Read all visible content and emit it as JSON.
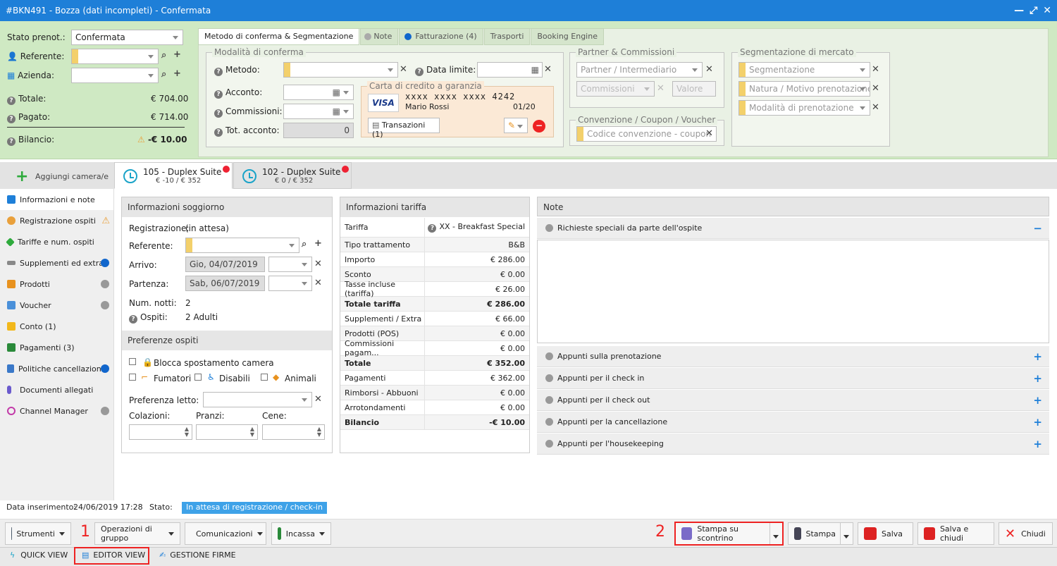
{
  "window": {
    "title": "#BKN491 - Bozza (dati incompleti) - Confermata",
    "min": "—",
    "max": "⤢",
    "close": "✕"
  },
  "header": {
    "stato_label": "Stato prenot.:",
    "stato_value": "Confermata",
    "referente_label": "Referente:",
    "azienda_label": "Azienda:",
    "totale_label": "Totale:",
    "totale_value": "€ 704.00",
    "pagato_label": "Pagato:",
    "pagato_value": "€ 714.00",
    "bilancio_label": "Bilancio:",
    "bilancio_value": "-€ 10.00"
  },
  "tabs": [
    "Metodo di conferma & Segmentazione",
    "Note",
    "Fatturazione (4)",
    "Trasporti",
    "Booking Engine"
  ],
  "conferma": {
    "legend": "Modalità di conferma",
    "metodo": "Metodo:",
    "data_limite": "Data limite:",
    "acconto": "Acconto:",
    "commissioni": "Commissioni:",
    "tot_acconto": "Tot. acconto:",
    "tot_acconto_value": "0",
    "carta_legend": "Carta di credito a garanzia",
    "card_brand": "VISA",
    "card_number": "xxxx xxxx xxxx 4242",
    "card_holder": "Mario Rossi",
    "card_exp": "01/20",
    "transazioni": "Transazioni (1)"
  },
  "partner": {
    "legend": "Partner & Commissioni",
    "partner_ph": "Partner / Intermediario",
    "commissioni_ph": "Commissioni",
    "valore_ph": "Valore"
  },
  "convenzione": {
    "legend": "Convenzione / Coupon / Voucher",
    "codice_ph": "Codice convenzione - coupon"
  },
  "segmentazione": {
    "legend": "Segmentazione di mercato",
    "seg_ph": "Segmentazione",
    "natura_ph": "Natura / Motivo prenotazione",
    "modalita_ph": "Modalità di prenotazione"
  },
  "rooms": {
    "add": "Aggiungi camera/e",
    "tabs": [
      {
        "name": "105 - Duplex Suite",
        "sub": "€ -10 / € 352"
      },
      {
        "name": "102 - Duplex Suite",
        "sub": "€ 0 / € 352"
      }
    ]
  },
  "sidebar": [
    {
      "label": "Informazioni e note",
      "color": "#1e7fd8",
      "dot": ""
    },
    {
      "label": "Registrazione ospiti",
      "color": "#e9a03b",
      "dot": "warn"
    },
    {
      "label": "Tariffe e num. ospiti",
      "color": "#2eaa3c",
      "dot": ""
    },
    {
      "label": "Supplementi ed extra",
      "color": "#888",
      "dot": "#1166cc"
    },
    {
      "label": "Prodotti",
      "color": "#e8921f",
      "dot": "#999"
    },
    {
      "label": "Voucher",
      "color": "#4a90d9",
      "dot": "#999"
    },
    {
      "label": "Conto (1)",
      "color": "#f2b81b",
      "dot": ""
    },
    {
      "label": "Pagamenti (3)",
      "color": "#2a8a3a",
      "dot": ""
    },
    {
      "label": "Politiche cancellazione",
      "color": "#3a78c8",
      "dot": "#1166cc"
    },
    {
      "label": "Documenti allegati",
      "color": "#6a5acd",
      "dot": ""
    },
    {
      "label": "Channel Manager",
      "color": "#c23aa8",
      "dot": "#999"
    }
  ],
  "soggiorno": {
    "title": "Informazioni soggiorno",
    "registrazione_label": "Registrazione:",
    "registrazione_value": "(in attesa)",
    "referente": "Referente:",
    "arrivo": "Arrivo:",
    "arrivo_value": "Gio, 04/07/2019",
    "partenza": "Partenza:",
    "partenza_value": "Sab, 06/07/2019",
    "notti": "Num. notti:",
    "notti_value": "2",
    "ospiti": "Ospiti:",
    "ospiti_value": "2 Adulti"
  },
  "preferenze": {
    "title": "Preferenze ospiti",
    "blocca": "Blocca spostamento camera",
    "fumatori": "Fumatori",
    "disabili": "Disabili",
    "animali": "Animali",
    "letto": "Preferenza letto:",
    "colazioni": "Colazioni:",
    "pranzi": "Pranzi:",
    "cene": "Cene:"
  },
  "tariffa": {
    "title": "Informazioni tariffa",
    "rows": [
      {
        "k": "Tariffa",
        "v": "XX - Breakfast Special",
        "b": false
      },
      {
        "k": "Tipo trattamento",
        "v": "B&B",
        "b": false
      },
      {
        "k": "Importo",
        "v": "€ 286.00",
        "b": false
      },
      {
        "k": "Sconto",
        "v": "€ 0.00",
        "b": false
      },
      {
        "k": "Tasse incluse (tariffa)",
        "v": "€ 26.00",
        "b": false
      },
      {
        "k": "Totale tariffa",
        "v": "€ 286.00",
        "b": true
      },
      {
        "k": "Supplementi / Extra",
        "v": "€ 66.00",
        "b": false
      },
      {
        "k": "Prodotti (POS)",
        "v": "€ 0.00",
        "b": false
      },
      {
        "k": "Commissioni pagam...",
        "v": "€ 0.00",
        "b": false
      },
      {
        "k": "Totale",
        "v": "€ 352.00",
        "b": true
      },
      {
        "k": "Pagamenti",
        "v": "€ 362.00",
        "b": false
      },
      {
        "k": "Rimborsi - Abbuoni",
        "v": "€ 0.00",
        "b": false
      },
      {
        "k": "Arrotondamenti",
        "v": "€ 0.00",
        "b": false
      },
      {
        "k": "Bilancio",
        "v": "-€ 10.00",
        "b": true
      }
    ]
  },
  "note": {
    "title": "Note",
    "richieste": "Richieste speciali da parte dell'ospite",
    "collapse": "−",
    "items": [
      "Appunti sulla prenotazione",
      "Appunti per il check in",
      "Appunti per il check out",
      "Appunti per la cancellazione",
      "Appunti per l'housekeeping"
    ],
    "expand": "+"
  },
  "info": {
    "data_label": "Data inserimento:",
    "data_value": "24/06/2019 17:28",
    "stato_label": "Stato:",
    "stato_value": "In attesa di registrazione / check-in"
  },
  "footer": {
    "strumenti": "Strumenti",
    "operazioni": "Operazioni di gruppo",
    "comunicazioni": "Comunicazioni",
    "incassa": "Incassa",
    "stampa_scontrino": "Stampa su scontrino",
    "stampa": "Stampa",
    "salva": "Salva",
    "salva_chiudi": "Salva e chiudi",
    "chiudi": "Chiudi",
    "mark1": "1",
    "mark2": "2"
  },
  "bottombar": {
    "quick": "QUICK VIEW",
    "editor": "EDITOR VIEW",
    "firme": "GESTIONE FIRME"
  }
}
